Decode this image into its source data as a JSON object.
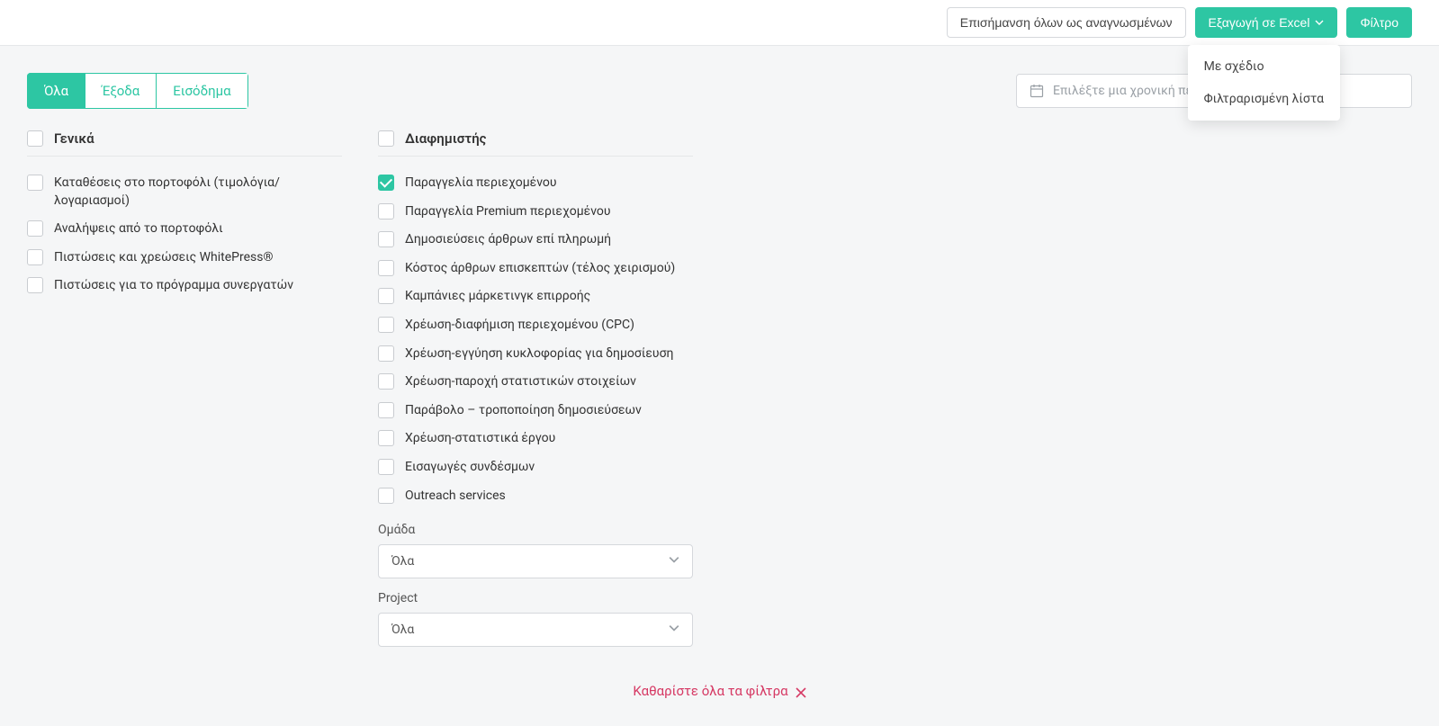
{
  "header": {
    "mark_read_label": "Επισήμανση όλων ως αναγνωσμένων",
    "export_label": "Εξαγωγή σε Excel",
    "filter_label": "Φίλτρο",
    "export_menu": {
      "scheduled": "Με σχέδιο",
      "filtered_list": "Φιλτραρισμένη λίστα"
    }
  },
  "tabs": {
    "all": "Όλα",
    "expenses": "Έξοδα",
    "income": "Εισόδημα"
  },
  "date_picker": {
    "placeholder": "Επιλέξτε μια χρονική περίοδο"
  },
  "general": {
    "title": "Γενικά",
    "items": [
      {
        "label": "Καταθέσεις στο πορτοφόλι (τιμολόγια/ λογαριασμοί)",
        "checked": false
      },
      {
        "label": "Αναλήψεις από το πορτοφόλι",
        "checked": false
      },
      {
        "label": "Πιστώσεις και χρεώσεις WhitePress®",
        "checked": false
      },
      {
        "label": "Πιστώσεις για το πρόγραμμα συνεργατών",
        "checked": false
      }
    ]
  },
  "advertiser": {
    "title": "Διαφημιστής",
    "items": [
      {
        "label": "Παραγγελία περιεχομένου",
        "checked": true
      },
      {
        "label": "Παραγγελία Premium περιεχομένου",
        "checked": false
      },
      {
        "label": "Δημοσιεύσεις άρθρων επί πληρωμή",
        "checked": false
      },
      {
        "label": "Κόστος άρθρων επισκεπτών (τέλος χειρισμού)",
        "checked": false
      },
      {
        "label": "Καμπάνιες μάρκετινγκ επιρροής",
        "checked": false
      },
      {
        "label": "Χρέωση-διαφήμιση περιεχομένου (CPC)",
        "checked": false
      },
      {
        "label": "Χρέωση-εγγύηση κυκλοφορίας για δημοσίευση",
        "checked": false
      },
      {
        "label": "Χρέωση-παροχή στατιστικών στοιχείων",
        "checked": false
      },
      {
        "label": "Παράβολο – τροποποίηση δημοσιεύσεων",
        "checked": false
      },
      {
        "label": "Χρέωση-στατιστικά έργου",
        "checked": false
      },
      {
        "label": "Εισαγωγές συνδέσμων",
        "checked": false
      },
      {
        "label": "Outreach services",
        "checked": false
      }
    ],
    "group_label": "Ομάδα",
    "group_value": "Όλα",
    "project_label": "Project",
    "project_value": "Όλα"
  },
  "clear_filters_label": "Καθαρίστε όλα τα φίλτρα"
}
